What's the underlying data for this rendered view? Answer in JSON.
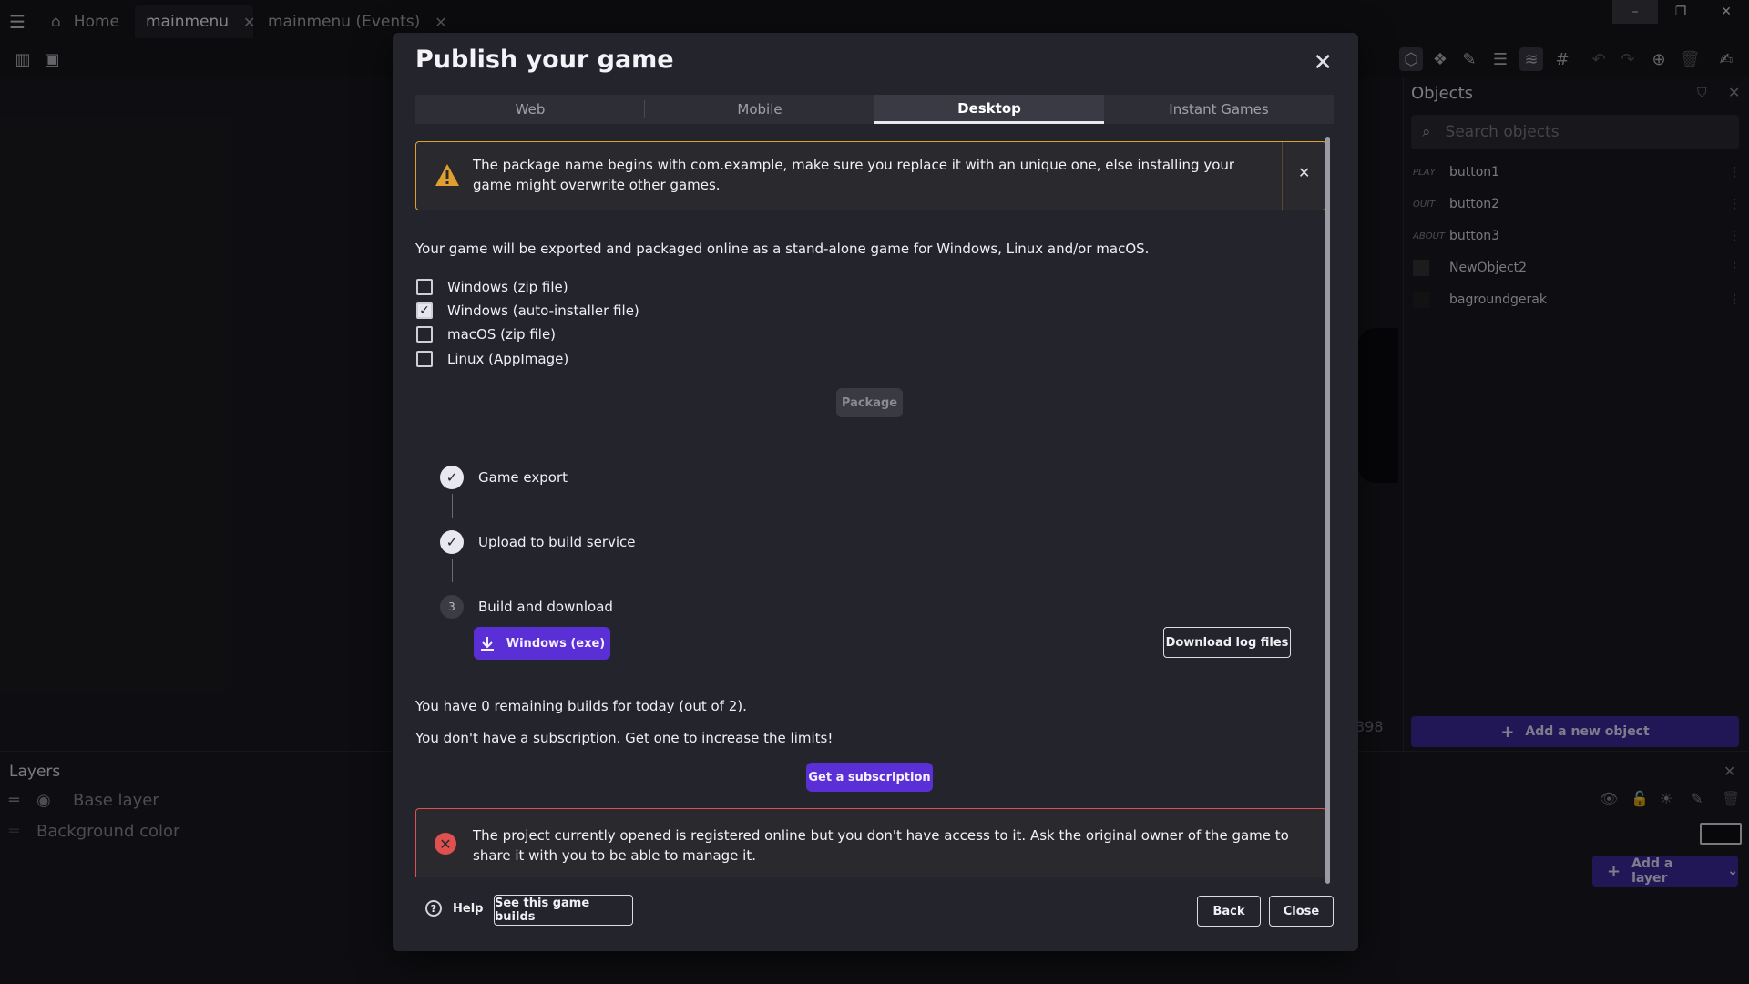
{
  "titlebar": {
    "tabs": [
      {
        "label": "Home"
      },
      {
        "label": "mainmenu"
      },
      {
        "label": "mainmenu (Events)"
      }
    ]
  },
  "objects_panel": {
    "title": "Objects",
    "search_placeholder": "Search objects",
    "items": [
      {
        "thumb": "PLAY",
        "name": "button1"
      },
      {
        "thumb": "QUIT",
        "name": "button2"
      },
      {
        "thumb": "ABOUT",
        "name": "button3"
      },
      {
        "thumb": "",
        "name": "NewObject2"
      },
      {
        "thumb": "",
        "name": "bagroundgerak"
      }
    ],
    "add_label": "Add a new object"
  },
  "scene": {
    "partial_number": "398"
  },
  "layers_panel": {
    "title": "Layers",
    "rows": [
      {
        "label": "Base layer"
      },
      {
        "label": "Background color"
      }
    ],
    "add_label": "Add a layer"
  },
  "dialog": {
    "title": "Publish your game",
    "tabs": [
      {
        "label": "Web"
      },
      {
        "label": "Mobile"
      },
      {
        "label": "Desktop"
      },
      {
        "label": "Instant Games"
      }
    ],
    "active_tab": "Desktop",
    "warning": "The package name begins with com.example, make sure you replace it with an unique one, else installing your game might overwrite other games.",
    "description": "Your game will be exported and packaged online as a stand-alone game for Windows, Linux and/or macOS.",
    "options": [
      {
        "label": "Windows (zip file)",
        "checked": false
      },
      {
        "label": "Windows (auto-installer file)",
        "checked": true
      },
      {
        "label": "macOS (zip file)",
        "checked": false
      },
      {
        "label": "Linux (AppImage)",
        "checked": false
      }
    ],
    "package_label": "Package",
    "steps": [
      {
        "label": "Game export",
        "state": "done"
      },
      {
        "label": "Upload to build service",
        "state": "done"
      },
      {
        "label": "Build and download",
        "state": "current",
        "number": "3"
      }
    ],
    "download_exe_label": "Windows (exe)",
    "download_log_label": "Download log files",
    "remaining_builds": "You have 0 remaining builds for today (out of 2).",
    "subscription_text": "You don't have a subscription. Get one to increase the limits!",
    "subscription_button": "Get a subscription",
    "error": "The project currently opened is registered online but you don't have access to it. Ask the original owner of the game to share it with you to be able to manage it.",
    "footer": {
      "help": "Help",
      "see_builds": "See this game builds",
      "back": "Back",
      "close": "Close"
    }
  },
  "colors": {
    "accent": "#5b2fd6",
    "warning": "#e0a030",
    "error": "#e05050"
  }
}
